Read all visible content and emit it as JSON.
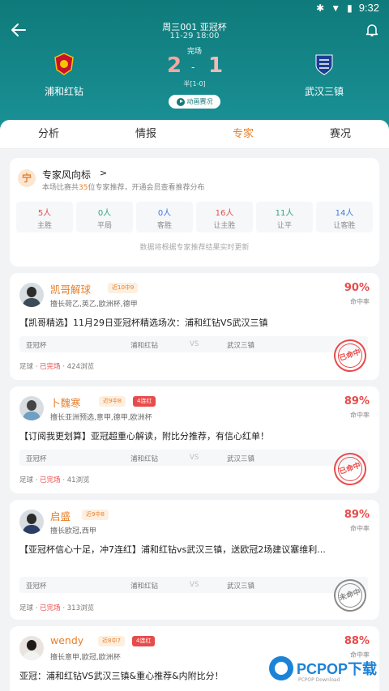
{
  "status_bar": {
    "time": "9:32"
  },
  "match": {
    "title": "周三001 亚冠杯",
    "datetime": "11-29 18:00",
    "status": "完场",
    "home": {
      "name": "浦和红钻",
      "score": "2"
    },
    "away": {
      "name": "武汉三镇",
      "score": "1"
    },
    "separator": "-",
    "halftime": "半[1-0]",
    "animation_label": "动画赛况"
  },
  "tabs": [
    {
      "label": "分析"
    },
    {
      "label": "情报"
    },
    {
      "label": "专家",
      "active": true
    },
    {
      "label": "赛况"
    }
  ],
  "vane": {
    "icon_char": "宁",
    "title": "专家风向标",
    "chevron": ">",
    "sub_pre": "本场比赛共",
    "sub_count": "35",
    "sub_post": "位专家推荐，开通会员查看推荐分布",
    "stats": [
      {
        "value": "5人",
        "label": "主胜",
        "color": "red"
      },
      {
        "value": "0人",
        "label": "平局",
        "color": "green"
      },
      {
        "value": "0人",
        "label": "客胜",
        "color": "blue"
      },
      {
        "value": "16人",
        "label": "让主胜",
        "color": "red"
      },
      {
        "value": "11人",
        "label": "让平",
        "color": "green"
      },
      {
        "value": "14人",
        "label": "让客胜",
        "color": "blue"
      }
    ],
    "note": "数据将根据专家推荐结果实时更新"
  },
  "experts": [
    {
      "name": "凯哥解球",
      "near": "近10中9",
      "streak": "",
      "spec": "擅长荷乙,英乙,欧洲杯,德甲",
      "rate": "90%",
      "rate_label": "命中率",
      "text": "【凯哥精选】11月29日亚冠杯精选场次：浦和红钻VS武汉三镇",
      "league": "亚冠杯",
      "home": "浦和红钻",
      "vs": "VS",
      "away": "武汉三镇",
      "foot_sport": "足球",
      "foot_status": "已完场",
      "foot_views": "424浏览",
      "stamp": "已命中",
      "stamp_type": "hit"
    },
    {
      "name": "卜魏寒",
      "near": "近9中8",
      "streak": "4连红",
      "spec": "擅长亚洲预选,意甲,德甲,欧洲杯",
      "rate": "89%",
      "rate_label": "命中率",
      "text": "【订阅我更划算】亚冠超重心解读，附比分推荐，有信心红单！",
      "league": "亚冠杯",
      "home": "浦和红钻",
      "vs": "VS",
      "away": "武汉三镇",
      "foot_sport": "足球",
      "foot_status": "已完场",
      "foot_views": "41浏览",
      "stamp": "已命中",
      "stamp_type": "hit"
    },
    {
      "name": "启盛",
      "near": "近9中8",
      "streak": "",
      "spec": "擅长欧冠,西甲",
      "rate": "89%",
      "rate_label": "命中率",
      "text": "【亚冠杯信心十足，冲7连红】浦和红钻vs武汉三镇，送欧冠2场建议塞维利...",
      "league": "亚冠杯",
      "home": "浦和红钻",
      "vs": "VS",
      "away": "武汉三镇",
      "foot_sport": "足球",
      "foot_status": "已完场",
      "foot_views": "313浏览",
      "stamp": "未命中",
      "stamp_type": "miss"
    },
    {
      "name": "wendy",
      "near": "近8中7",
      "streak": "4连红",
      "spec": "擅长意甲,欧冠,欧洲杯",
      "rate": "88%",
      "rate_label": "命中率",
      "text": "亚冠：浦和红钻VS武汉三镇&重心推荐&内附比分！"
    }
  ],
  "watermark": {
    "main": "PCPOP下载",
    "sub": "PCPOP Download"
  }
}
